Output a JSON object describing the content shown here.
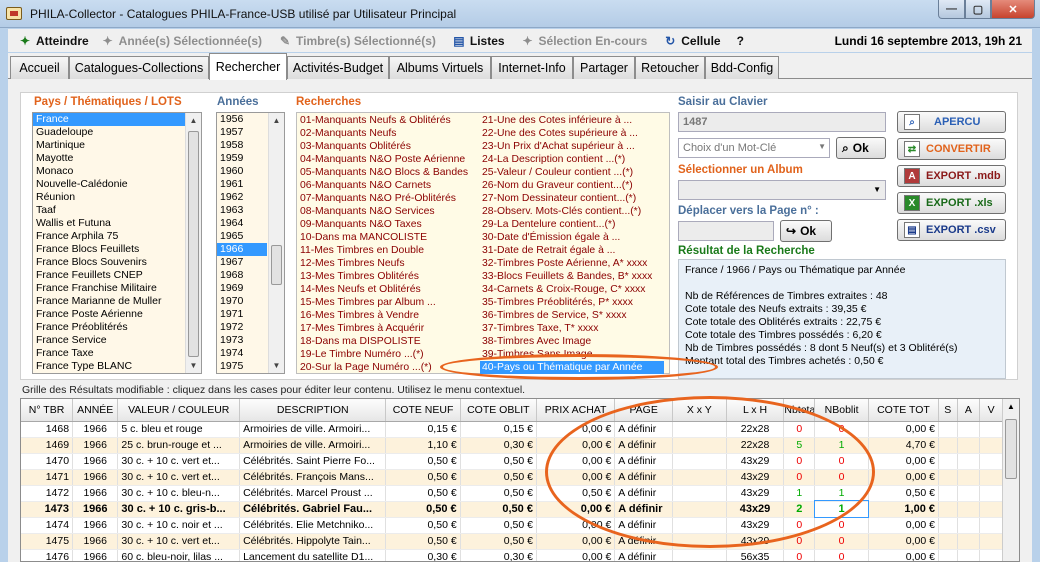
{
  "window": {
    "title": "PHILA-Collector - Catalogues PHILA-France-USB utilisé par Utilisateur Principal"
  },
  "menubar": {
    "items": [
      {
        "label": "Atteindre",
        "icon": "✦"
      },
      {
        "label": "Année(s) Sélectionnée(s)",
        "icon": "✦"
      },
      {
        "label": "Timbre(s) Sélectionné(s)",
        "icon": "✎"
      },
      {
        "label": "Listes",
        "icon": "▤"
      },
      {
        "label": "Sélection En-cours",
        "icon": "✦"
      },
      {
        "label": "Cellule",
        "icon": "↻"
      },
      {
        "label": "?",
        "icon": ""
      }
    ],
    "datetime": "Lundi 16 septembre 2013, 19h 21"
  },
  "tabs": [
    "Accueil",
    "Catalogues-Collections",
    "Rechercher",
    "Activités-Budget",
    "Albums Virtuels",
    "Internet-Info",
    "Partager",
    "Retoucher",
    "Bdd-Config"
  ],
  "pays": {
    "label": "Pays / Thématiques / LOTS",
    "items": [
      "France",
      "Guadeloupe",
      "Martinique",
      "Mayotte",
      "Monaco",
      "Nouvelle-Calédonie",
      "Réunion",
      "Taaf",
      "Wallis et Futuna",
      "France Arphila 75",
      "France Blocs Feuillets",
      "France Blocs Souvenirs",
      "France Feuillets CNEP",
      "France Franchise Militaire",
      "France Marianne de Muller",
      "France Poste Aérienne",
      "France Préoblitérés",
      "France Service",
      "France Taxe",
      "France Type BLANC"
    ]
  },
  "annees": {
    "label": "Années",
    "items": [
      "1956",
      "1957",
      "1958",
      "1959",
      "1960",
      "1961",
      "1962",
      "1963",
      "1964",
      "1965",
      "1966",
      "1967",
      "1968",
      "1969",
      "1970",
      "1971",
      "1972",
      "1973",
      "1974",
      "1975"
    ]
  },
  "recherches": {
    "label": "Recherches",
    "col1": [
      "01-Manquants Neufs & Oblitérés",
      "02-Manquants Neufs",
      "03-Manquants Oblitérés",
      "04-Manquants N&O Poste Aérienne",
      "05-Manquants N&O Blocs & Bandes",
      "06-Manquants N&O Carnets",
      "07-Manquants N&O Pré-Oblitérés",
      "08-Manquants N&O Services",
      "09-Manquants N&O Taxes",
      "10-Dans ma MANCOLISTE",
      "11-Mes Timbres en Double",
      "12-Mes Timbres Neufs",
      "13-Mes Timbres Oblitérés",
      "14-Mes Neufs et Oblitérés",
      "15-Mes Timbres par Album ...",
      "16-Mes Timbres à Vendre",
      "17-Mes Timbres à Acquérir",
      "18-Dans ma DISPOLISTE",
      "19-Le Timbre Numéro ...(*)",
      "20-Sur la Page Numéro ...(*)"
    ],
    "col2": [
      "21-Une des Cotes inférieure à ...",
      "22-Une des Cotes supérieure à ...",
      "23-Un Prix d'Achat supérieur à ...",
      "24-La Description contient ...(*)",
      "25-Valeur / Couleur contient ...(*)",
      "26-Nom du Graveur contient...(*)",
      "27-Nom Dessinateur contient...(*)",
      "28-Observ. Mots-Clés contient...(*)",
      "29-La Dentelure contient...(*)",
      "30-Date d'Émission égale à ...",
      "31-Date de Retrait égale à ...",
      "32-Timbres Poste Aérienne, A* xxxx",
      "33-Blocs Feuillets & Bandes, B* xxxx",
      "34-Carnets & Croix-Rouge, C* xxxx",
      "35-Timbres Préoblitérés, P* xxxx",
      "36-Timbres de Service, S* xxxx",
      "37-Timbres Taxe, T* xxxx",
      "38-Timbres Avec Image",
      "39-Timbres Sans Image",
      "40-Pays ou Thématique par Année"
    ]
  },
  "clavier": {
    "label": "Saisir au Clavier",
    "value": "1487"
  },
  "motcle": {
    "placeholder": "Choix d'un Mot-Clé",
    "ok": "Ok"
  },
  "album": {
    "label": "Sélectionner un Album"
  },
  "page": {
    "label": "Déplacer vers la Page n° :",
    "ok": "Ok"
  },
  "buttons": {
    "apercu": "APERCU",
    "convertir": "CONVERTIR",
    "mdb": "EXPORT .mdb",
    "xls": "EXPORT .xls",
    "csv": "EXPORT .csv"
  },
  "result": {
    "label": "Résultat de la Recherche",
    "lines": [
      "France / 1966 / Pays ou Thématique par Année",
      "",
      "Nb de Références de Timbres extraites : 48",
      "Cote totale des Neufs extraits : 39,35 €",
      "Cote totale des Oblitérés extraits : 22,75 €",
      "Cote totale des Timbres possédés : 6,20 €",
      "Nb de Timbres possédés : 8 dont 5 Neuf(s) et 3 Oblitéré(s)",
      "Montant total des Timbres achetés : 0,50 €"
    ]
  },
  "grid": {
    "label": "Grille des Résultats modifiable : cliquez dans les cases pour éditer leur contenu. Utilisez le menu contextuel.",
    "headers": [
      "N° TBR",
      "ANNÉE",
      "VALEUR / COULEUR",
      "DESCRIPTION",
      "COTE NEUF",
      "COTE OBLIT",
      "PRIX ACHAT",
      "PAGE",
      "X x Y",
      "L x H",
      "Nbtotal",
      "NBoblit",
      "COTE TOT",
      "S",
      "A",
      "V"
    ],
    "rows": [
      [
        "1468",
        "1966",
        "5 c. bleu et rouge",
        "Armoiries de ville. Armoiri...",
        "0,15 €",
        "0,15 €",
        "0,00 €",
        "A définir",
        "",
        "22x28",
        "0",
        "0",
        "0,00 €",
        "",
        "",
        ""
      ],
      [
        "1469",
        "1966",
        "25 c. brun-rouge et ...",
        "Armoiries de ville. Armoiri...",
        "1,10 €",
        "0,30 €",
        "0,00 €",
        "A définir",
        "",
        "22x28",
        "5",
        "1",
        "4,70 €",
        "",
        "",
        ""
      ],
      [
        "1470",
        "1966",
        "30 c. + 10 c. vert et...",
        "Célébrités. Saint Pierre Fo...",
        "0,50 €",
        "0,50 €",
        "0,00 €",
        "A définir",
        "",
        "43x29",
        "0",
        "0",
        "0,00 €",
        "",
        "",
        ""
      ],
      [
        "1471",
        "1966",
        "30 c. + 10 c. vert et...",
        "Célébrités. François Mans...",
        "0,50 €",
        "0,50 €",
        "0,00 €",
        "A définir",
        "",
        "43x29",
        "0",
        "0",
        "0,00 €",
        "",
        "",
        ""
      ],
      [
        "1472",
        "1966",
        "30 c. + 10 c. bleu-n...",
        "Célébrités. Marcel Proust ...",
        "0,50 €",
        "0,50 €",
        "0,50 €",
        "A définir",
        "",
        "43x29",
        "1",
        "1",
        "0,50 €",
        "",
        "",
        ""
      ],
      [
        "1473",
        "1966",
        "30 c. + 10 c. gris-b...",
        "Célébrités. Gabriel Fau...",
        "0,50 €",
        "0,50 €",
        "0,00 €",
        "A définir",
        "",
        "43x29",
        "2",
        "1",
        "1,00 €",
        "",
        "",
        ""
      ],
      [
        "1474",
        "1966",
        "30 c. + 10 c. noir et ...",
        "Célébrités. Elie Metchniko...",
        "0,50 €",
        "0,50 €",
        "0,00 €",
        "A définir",
        "",
        "43x29",
        "0",
        "0",
        "0,00 €",
        "",
        "",
        ""
      ],
      [
        "1475",
        "1966",
        "30 c. + 10 c. vert et...",
        "Célébrités. Hippolyte Tain...",
        "0,50 €",
        "0,50 €",
        "0,00 €",
        "A définir",
        "",
        "43x29",
        "0",
        "0",
        "0,00 €",
        "",
        "",
        ""
      ],
      [
        "1476",
        "1966",
        "60 c. bleu-noir, lilas ...",
        "Lancement du satellite D1...",
        "0,30 €",
        "0,30 €",
        "0,00 €",
        "A définir",
        "",
        "56x35",
        "0",
        "0",
        "0,00 €",
        "",
        "",
        ""
      ]
    ]
  }
}
